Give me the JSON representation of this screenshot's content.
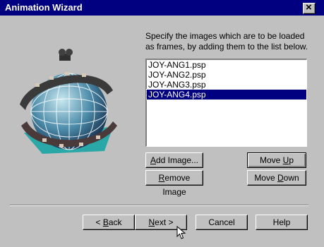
{
  "window": {
    "title": "Animation Wizard",
    "close_icon": "close-icon"
  },
  "instructions": "Specify the images which are to be loaded as frames, by adding them to the list below.",
  "frames": [
    "JOY-ANG1.psp",
    "JOY-ANG2.psp",
    "JOY-ANG3.psp",
    "JOY-ANG4.psp"
  ],
  "selected_frame": "JOY-ANG4.psp",
  "buttons": {
    "add_image": {
      "pre": "",
      "u": "A",
      "post": "dd Image..."
    },
    "remove_image": {
      "pre": "",
      "u": "R",
      "post": "emove Image"
    },
    "move_up": {
      "pre": "Move ",
      "u": "U",
      "post": "p"
    },
    "move_down": {
      "pre": "Move ",
      "u": "D",
      "post": "own"
    },
    "back": {
      "pre": "< ",
      "u": "B",
      "post": "ack"
    },
    "next": {
      "pre": "",
      "u": "N",
      "post": "ext >"
    },
    "cancel": {
      "pre": "Cancel",
      "u": "",
      "post": ""
    },
    "help": {
      "pre": "Help",
      "u": "",
      "post": ""
    }
  },
  "colors": {
    "titlebar": "#000080",
    "dialog": "#c0c0c0",
    "selection": "#000080"
  }
}
